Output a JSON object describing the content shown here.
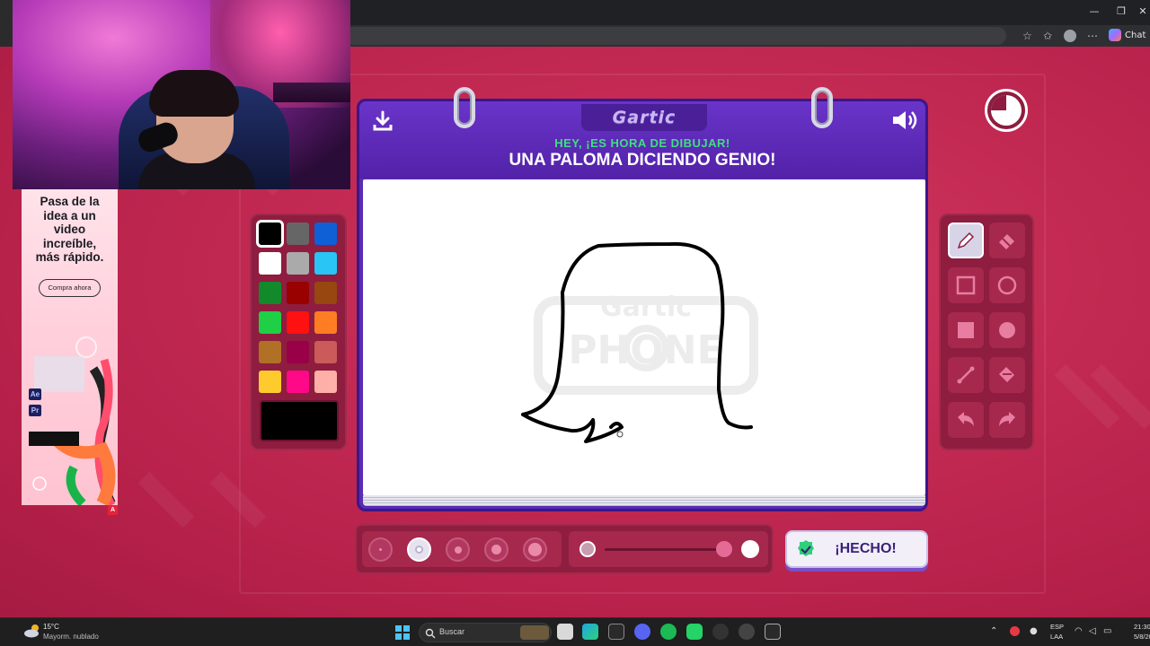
{
  "browser": {
    "window_controls": [
      "—",
      "❐",
      "✕"
    ],
    "toolbar_icons": [
      "star-outline-icon",
      "favorites-icon",
      "profile-icon",
      "more-icon"
    ],
    "chat_label": "Chat"
  },
  "ad": {
    "headline": "Pasa de la\nidea a un\nvideo\nincreíble,\nmás rápido.",
    "button_label": "Compra ahora",
    "badges": [
      "Ae",
      "Pr"
    ]
  },
  "game": {
    "logo_text": "Gartic",
    "prompt_subtitle": "HEY, ¡ES HORA DE DIBUJAR!",
    "prompt_title": "UNA PALOMA DICIENDO GENIO!",
    "watermark_top": "Gartic",
    "watermark_bottom": "PHONE",
    "done_label": "¡HECHO!",
    "selected_color": "#000000",
    "palette": [
      "#000000",
      "#666666",
      "#0f5fd6",
      "#ffffff",
      "#aaaaaa",
      "#28c5f5",
      "#128a2b",
      "#990000",
      "#97470f",
      "#1fcf46",
      "#ff1111",
      "#ff7d22",
      "#b07026",
      "#990048",
      "#cb5a5a",
      "#fecb2f",
      "#ff0989",
      "#feafa8"
    ],
    "tools": [
      "pencil-icon",
      "eraser-icon",
      "rectangle-outline-icon",
      "circle-outline-icon",
      "rectangle-filled-icon",
      "circle-filled-icon",
      "line-icon",
      "fill-bucket-icon",
      "undo-icon",
      "redo-icon"
    ],
    "selected_tool": "pencil-icon",
    "brush_sizes": 5,
    "selected_brush_size": 2
  },
  "taskbar": {
    "weather_temp": "15°C",
    "weather_desc": "Mayorm. nublado",
    "search_placeholder": "Buscar",
    "lang_line1": "ESP",
    "lang_line2": "LAA",
    "time": "21:30",
    "date": "5/8/2025"
  }
}
